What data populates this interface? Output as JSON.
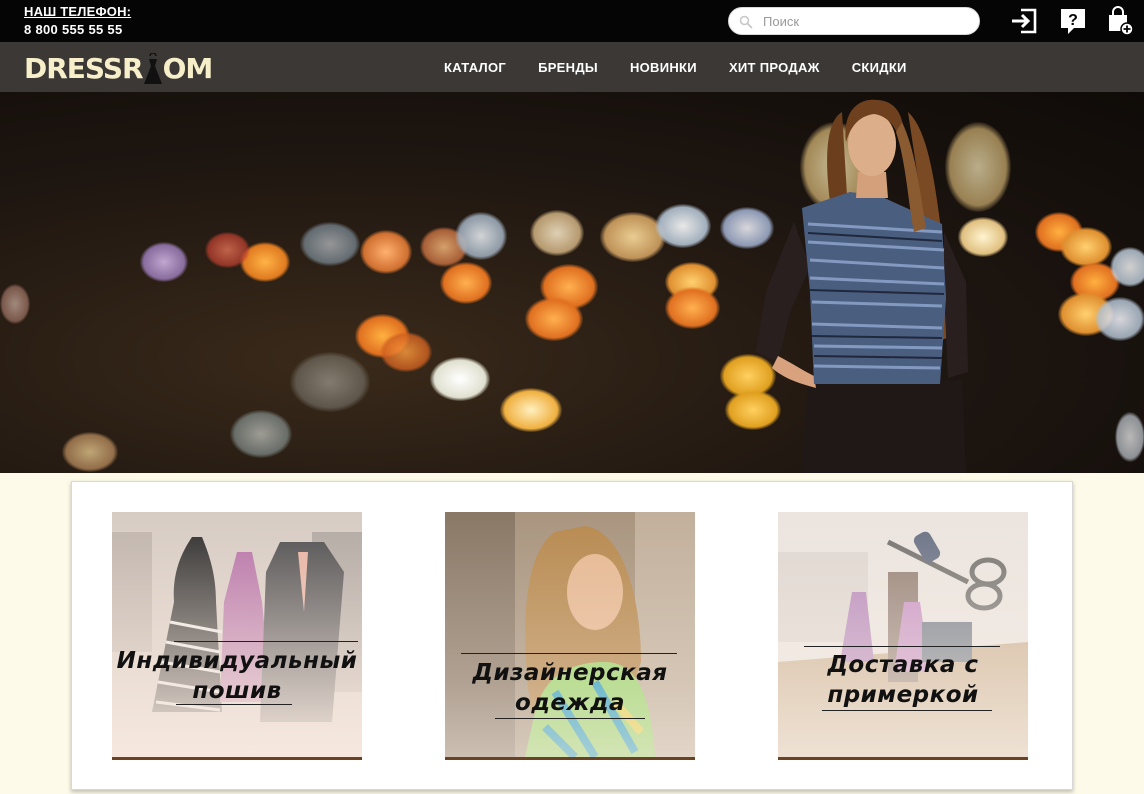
{
  "header": {
    "phone_label": "НАШ ТЕЛЕФОН:",
    "phone_number": "8 800 555 55 55",
    "search_placeholder": "Поиск",
    "icons": [
      "login-icon",
      "help-icon",
      "cart-icon"
    ]
  },
  "brand": {
    "logo_text_left": "DRESSR",
    "logo_text_right": "OM"
  },
  "nav": {
    "items": [
      "КАТАЛОГ",
      "БРЕНДЫ",
      "НОВИНКИ",
      "ХИТ ПРОДАЖ",
      "СКИДКИ"
    ]
  },
  "features": [
    {
      "line1": "Индивидуальный",
      "line2": "пошив"
    },
    {
      "line1": "Дизайнерская",
      "line2": "одежда"
    },
    {
      "line1": "Доставка с",
      "line2": "примеркой"
    }
  ],
  "colors": {
    "topbar": "#050505",
    "navbar": "#3b3836",
    "logo": "#f7efc9",
    "page_background": "#fefae9",
    "card_border": "#6b4322"
  }
}
